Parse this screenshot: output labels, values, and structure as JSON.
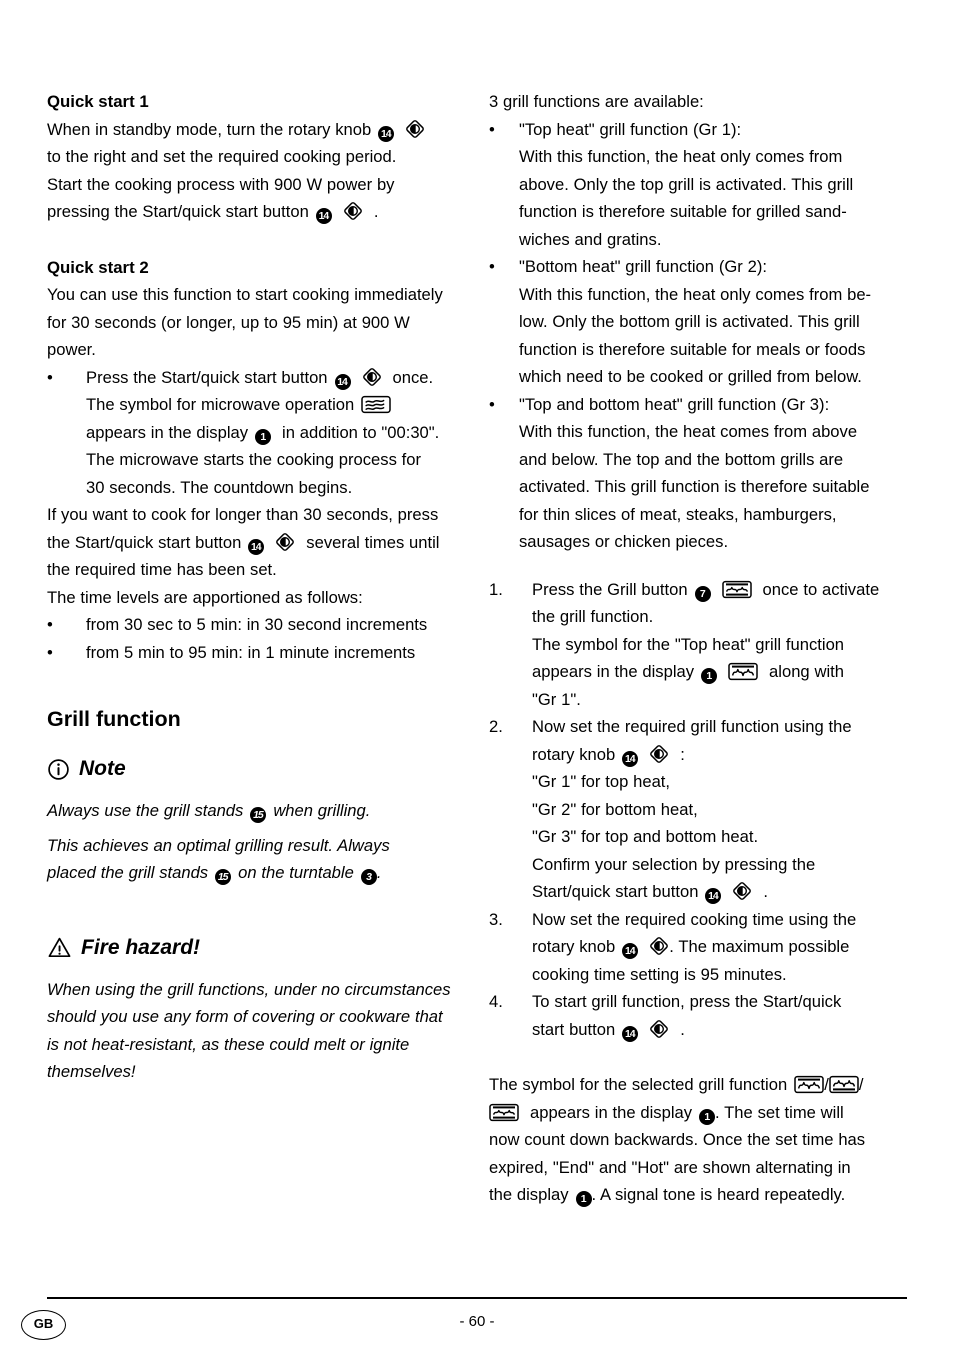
{
  "document": {
    "language_badge": "GB",
    "page_number": "- 60 -"
  },
  "left_column": {
    "quick_start_1": {
      "heading": "Quick start 1",
      "line1_a": "When in standby mode, turn the rotary knob",
      "line2": "to the right and set the required cooking period.",
      "line3": "Start the cooking process with 900 W power by",
      "line4_a": "pressing the Start/quick start button",
      "line4_b": "."
    },
    "quick_start_2": {
      "heading": "Quick start 2",
      "line1": "You can use this function to start cooking immediately",
      "line2": "for 30 seconds (or longer, up to 95 min) at 900 W",
      "line3": "power.",
      "bullet_mark": "•",
      "b1_line1_a": "Press the Start/quick start button",
      "b1_line1_b": "once.",
      "b1_line2_a": "The symbol for microwave operation",
      "b1_line3_a": "appears in the display",
      "b1_line3_b": "in addition to \"00:30\".",
      "b1_line4": "The microwave starts the cooking process for",
      "b1_line5": "30 seconds. The countdown begins.",
      "after_line1": "If you want to cook for longer than 30 seconds, press",
      "after_line2_a": "the Start/quick start button",
      "after_line2_b": "several times until",
      "after_line3": "the required time has been set.",
      "after_line4": "The time levels are apportioned as follows:",
      "levels": [
        "from 30 sec to 5 min: in 30 second increments",
        "from 5 min to 95 min: in 1 minute increments"
      ]
    },
    "grill_function": {
      "heading": "Grill function",
      "note": {
        "title": "Note",
        "icon": "info-circle-icon",
        "line1_a": "Always use the grill stands",
        "line1_b": "when grilling.",
        "line2": "This achieves an optimal grilling result. Always",
        "line3_a": "placed the grill stands",
        "line3_b": "on the turntable",
        "line3_c": "."
      },
      "warning": {
        "title": "Fire hazard!",
        "icon": "warning-triangle-icon",
        "line1": "When using the grill functions, under no circumstances",
        "line2": "should you use any form of covering or cookware that",
        "line3": "is not heat-resistant, as these could melt or ignite",
        "line4": "themselves!"
      }
    }
  },
  "right_column": {
    "intro": "3 grill functions are available:",
    "bullet_mark": "•",
    "functions": [
      {
        "title": "\"Top heat\" grill function (Gr 1):",
        "lines": [
          "With this function, the heat only comes from",
          "above. Only the top grill is activated. This grill",
          "function is therefore suitable for grilled sand-",
          "wiches and gratins."
        ]
      },
      {
        "title": "\"Bottom heat\" grill function (Gr 2):",
        "lines": [
          "With this function, the heat only comes from be-",
          "low. Only the bottom grill is activated. This grill",
          "function is therefore suitable for meals or foods",
          "which need to be cooked or grilled from below."
        ]
      },
      {
        "title": "\"Top and bottom heat\" grill function (Gr 3):",
        "lines": [
          "With this function, the heat comes from above",
          "and below. The top and the bottom grills are",
          "activated. This grill function is therefore suitable",
          "for thin slices of meat, steaks, hamburgers,",
          "sausages or chicken pieces."
        ]
      }
    ],
    "steps": {
      "s1_mark": "1.",
      "s1_line1_a": "Press the Grill button",
      "s1_line1_b": "once to activate",
      "s1_line2": "the grill function.",
      "s1_line3": "The symbol for the \"Top heat\" grill function",
      "s1_line4_a": "appears in the display",
      "s1_line4_b": "along with",
      "s1_line5": "\"Gr 1\".",
      "s2_mark": "2.",
      "s2_line1": "Now set the required grill function using the",
      "s2_line2_a": "rotary knob",
      "s2_line2_b": ":",
      "s2_line3": "\"Gr 1\" for top heat,",
      "s2_line4": "\"Gr 2\" for bottom heat,",
      "s2_line5": "\"Gr 3\" for top and bottom heat.",
      "s2_line6": "Confirm your selection by pressing the",
      "s2_line7_a": "Start/quick start button",
      "s2_line7_b": ".",
      "s3_mark": "3.",
      "s3_line1": "Now set the required cooking time using the",
      "s3_line2_a": "rotary knob",
      "s3_line2_b": ". The maximum possible",
      "s3_line3": "cooking time setting is 95 minutes.",
      "s4_mark": "4.",
      "s4_line1": "To start grill function, press the Start/quick",
      "s4_line2_a": "start button",
      "s4_line2_b": "."
    },
    "closing": {
      "line1_a": "The symbol for the selected grill function",
      "slash": "/",
      "line2_a": "appears in the display",
      "line2_b": ". The set time will",
      "line3": "now count down backwards. Once the set time has",
      "line4": "expired, \"End\" and \"Hot\" are shown alternating in",
      "line5_a": "the display",
      "line5_b": ". A signal tone is heard repeatedly."
    }
  },
  "reference_numbers": {
    "display": "1",
    "turntable": "3",
    "grill_button": "7",
    "rotary_knob": "14",
    "grill_stands": "15"
  },
  "icons": {
    "rotary_knob_icon": "rotary-knob-diamond-icon",
    "microwave_icon": "microwave-waves-icon",
    "grill_top_icon": "grill-top-heat-icon",
    "grill_bottom_icon": "grill-bottom-heat-icon",
    "grill_both_icon": "grill-top-bottom-heat-icon"
  },
  "colors": {
    "text": "#000000",
    "background": "#ffffff"
  }
}
